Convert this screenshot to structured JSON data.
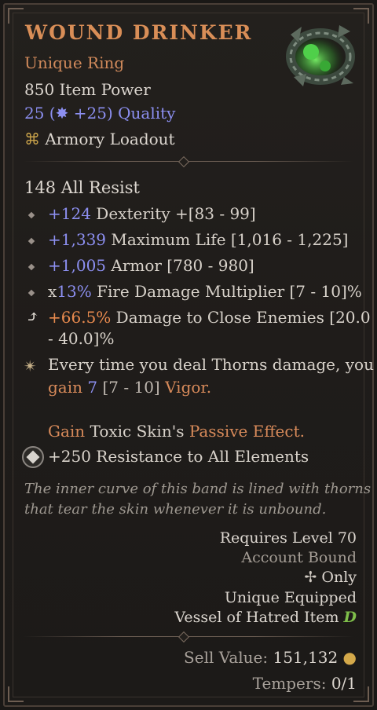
{
  "item": {
    "name": "WOUND DRINKER",
    "type": "Unique Ring",
    "item_power": "850 Item Power",
    "quality_value": "25",
    "quality_bonus": "+25",
    "quality_label": "Quality",
    "loadout": "Armory Loadout"
  },
  "base_stat": "148 All Resist",
  "affixes": [
    {
      "value": "+124",
      "text": "Dexterity +[83 - 99]"
    },
    {
      "value": "+1,339",
      "text": "Maximum Life [1,016 - 1,225]"
    },
    {
      "value": "+1,005",
      "text": "Armor [780 - 980]"
    },
    {
      "prefix": "x",
      "value": "13%",
      "text": "Fire Damage Multiplier [7 - 10]%"
    },
    {
      "value": "+66.5%",
      "text": "Damage to Close Enemies [20.0",
      "text2": "- 40.0]%"
    }
  ],
  "unique": {
    "line1": "Every time you deal Thorns damage, you",
    "line2_a": "gain",
    "line2_val": "7",
    "line2_range": "[7 - 10]",
    "line2_b": "Vigor."
  },
  "passive": {
    "a": "Gain",
    "b": "Toxic Skin's",
    "c": "Passive Effect."
  },
  "socket_bonus": "+250 Resistance to All Elements",
  "lore": {
    "line1": "The inner curve of this band is lined with thorns",
    "line2": "that tear the skin whenever it is unbound."
  },
  "requirements": {
    "level": "Requires Level 70",
    "bound": "Account Bound",
    "only": "Only",
    "unique_equipped": "Unique Equipped",
    "vessel": "Vessel of Hatred Item"
  },
  "footer": {
    "sell_label": "Sell Value:",
    "sell_value": "151,132",
    "tempers_label": "Tempers:",
    "tempers_value": "0/1"
  },
  "colors": {
    "title": "#d98e57",
    "magic_blue": "#8c8ff0",
    "unique_orange": "#d78a5a"
  }
}
